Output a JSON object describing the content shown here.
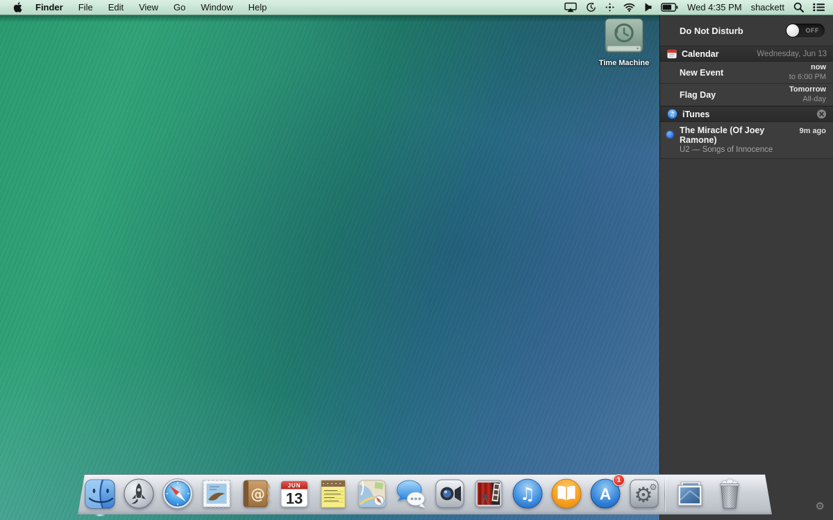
{
  "menu_bar": {
    "app_menu": "Finder",
    "menus": [
      "File",
      "Edit",
      "View",
      "Go",
      "Window",
      "Help"
    ],
    "status": {
      "clock": "Wed 4:35 PM",
      "user": "shackett"
    },
    "status_icon_names": [
      "airplay-icon",
      "time-machine-icon",
      "location-crosshair-icon",
      "wifi-icon",
      "volume-icon",
      "battery-icon",
      "spotlight-search-icon",
      "notification-center-icon"
    ]
  },
  "desktop": {
    "time_machine_label": "Time Machine"
  },
  "notification_center": {
    "do_not_disturb": {
      "label": "Do Not Disturb",
      "state": "OFF"
    },
    "sections": [
      {
        "app": "Calendar",
        "header_right": "Wednesday, Jun 13",
        "items": [
          {
            "title": "New Event",
            "right_top": "now",
            "right_bottom": "to 6:00 PM"
          },
          {
            "title": "Flag Day",
            "right_top": "Tomorrow",
            "right_bottom": "All-day"
          }
        ]
      },
      {
        "app": "iTunes",
        "items": [
          {
            "title": "The Miracle (Of Joey Ramone)",
            "subtitle": "U2 — Songs of Innocence",
            "time": "9m ago"
          }
        ]
      }
    ]
  },
  "dock": {
    "apps": [
      {
        "id": "finder",
        "name": "Finder",
        "running": true
      },
      {
        "id": "launchpad",
        "name": "Launchpad"
      },
      {
        "id": "safari",
        "name": "Safari"
      },
      {
        "id": "mail",
        "name": "Mail"
      },
      {
        "id": "contacts",
        "name": "Contacts"
      },
      {
        "id": "calendar",
        "name": "Calendar",
        "month": "JUN",
        "day": "13"
      },
      {
        "id": "notes",
        "name": "Notes"
      },
      {
        "id": "maps",
        "name": "Maps"
      },
      {
        "id": "messages",
        "name": "Messages"
      },
      {
        "id": "facetime",
        "name": "FaceTime"
      },
      {
        "id": "photobooth",
        "name": "Photo Booth"
      },
      {
        "id": "itunes",
        "name": "iTunes"
      },
      {
        "id": "ibooks",
        "name": "iBooks"
      },
      {
        "id": "appstore",
        "name": "App Store",
        "badge": "1"
      },
      {
        "id": "sysprefs",
        "name": "System Preferences"
      }
    ],
    "stacks": [
      {
        "id": "pictures",
        "name": "Pictures Stack"
      },
      {
        "id": "trash",
        "name": "Trash"
      }
    ]
  },
  "icons": {
    "gear": "⚙"
  },
  "colors": {
    "menu_bar_tint": "#c9e6d4",
    "nc_background": "#3a3a3a",
    "notification_dot_blue": "#2e7cf7",
    "badge_red": "#d5281c",
    "wallpaper_green": "#2a9b70",
    "wallpaper_blue": "#4b7aa9"
  }
}
